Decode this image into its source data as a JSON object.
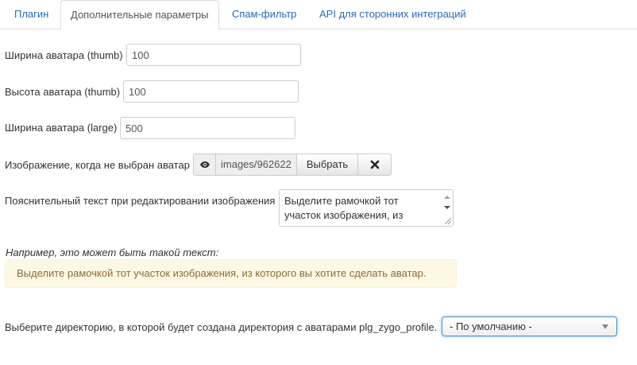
{
  "tabs": [
    {
      "label": "Плагин",
      "active": false
    },
    {
      "label": "Дополнительные параметры",
      "active": true
    },
    {
      "label": "Спам-фильтр",
      "active": false
    },
    {
      "label": "API для сторонних интеграций",
      "active": false
    }
  ],
  "fields": {
    "thumb_width": {
      "label": "Ширина аватара (thumb)",
      "value": "100"
    },
    "thumb_height": {
      "label": "Высота аватара (thumb)",
      "value": "100"
    },
    "large_width": {
      "label": "Ширина аватара (large)",
      "value": "500"
    },
    "default_image": {
      "label": "Изображение, когда не выбран аватар",
      "preview_icon": "eye-icon",
      "path": "images/962622",
      "select_label": "Выбрать",
      "clear_icon": "close-icon"
    },
    "crop_hint": {
      "label": "Пояснительный текст при редактировании изображения",
      "value": "Выделите рамочкой тот участок изображения, из"
    }
  },
  "example": {
    "label": "Например, это может быть такой текст:",
    "text": "Выделите рамочкой тот участок изображения, из которого вы хотите сделать аватар."
  },
  "directory": {
    "label": "Выберите директорию, в которой будет создана директория с аватарами plg_zygo_profile.",
    "selected": "- По умолчанию -"
  },
  "colors": {
    "link": "#2a69b8",
    "alert_bg": "#fcf8e3",
    "alert_text": "#8a6d3b",
    "focus_border": "#4d90c8"
  }
}
